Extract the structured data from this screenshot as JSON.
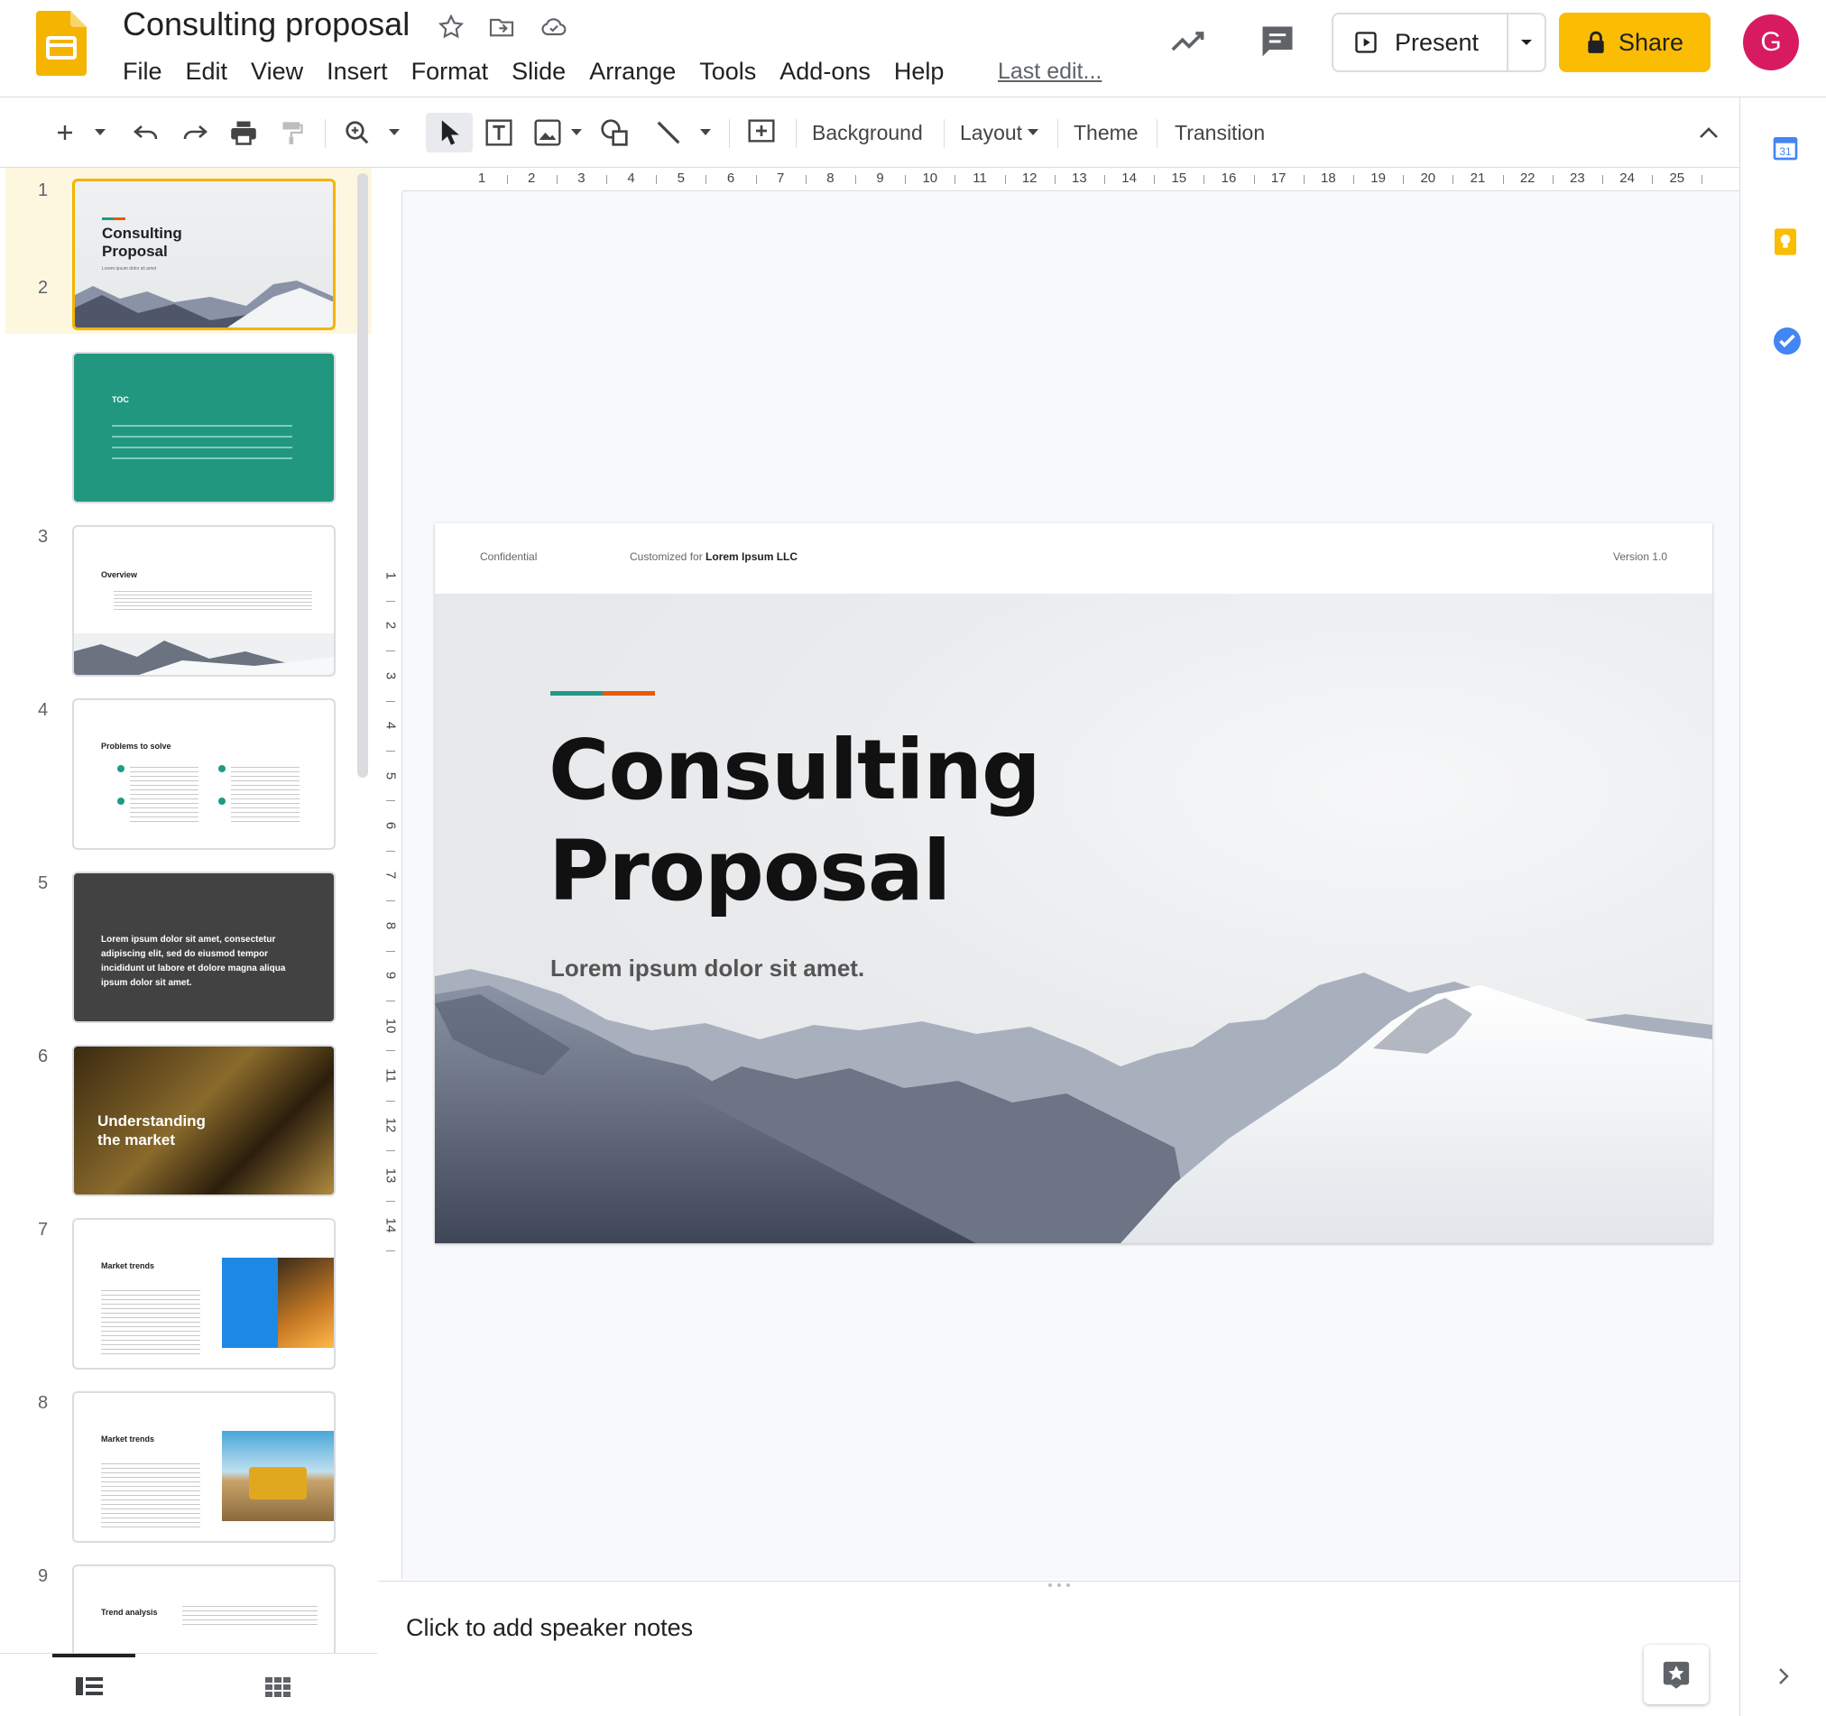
{
  "app": {
    "doc_title": "Consulting proposal",
    "menu": [
      "File",
      "Edit",
      "View",
      "Insert",
      "Format",
      "Slide",
      "Arrange",
      "Tools",
      "Add-ons",
      "Help"
    ],
    "last_edit": "Last edit...",
    "present_label": "Present",
    "share_label": "Share",
    "avatar_initial": "G"
  },
  "toolbar": {
    "background_label": "Background",
    "layout_label": "Layout",
    "theme_label": "Theme",
    "transition_label": "Transition"
  },
  "ruler": {
    "top": [
      "1",
      "2",
      "3",
      "4",
      "5",
      "6",
      "7",
      "8",
      "9",
      "10",
      "11",
      "12",
      "13",
      "14",
      "15",
      "16",
      "17",
      "18",
      "19",
      "20",
      "21",
      "22",
      "23",
      "24",
      "25"
    ],
    "left": [
      "1",
      "2",
      "3",
      "4",
      "5",
      "6",
      "7",
      "8",
      "9",
      "10",
      "11",
      "12",
      "13",
      "14"
    ]
  },
  "filmstrip": {
    "slides": [
      {
        "num": "1",
        "title": "Consulting Proposal",
        "subtitle": "Lorem ipsum dolor sit amet"
      },
      {
        "num": "2",
        "title": "TOC"
      },
      {
        "num": "3",
        "title": "Overview"
      },
      {
        "num": "4",
        "title": "Problems to solve"
      },
      {
        "num": "5",
        "title": "Lorem ipsum dolor sit amet, consectetur adipiscing elit, sed do eiusmod tempor incididunt ut labore et dolore magna aliqua ipsum dolor sit amet."
      },
      {
        "num": "6",
        "title": "Understanding the market"
      },
      {
        "num": "7",
        "title": "Market trends"
      },
      {
        "num": "8",
        "title": "Market trends"
      },
      {
        "num": "9",
        "title": "Trend analysis"
      }
    ]
  },
  "slide": {
    "confidential": "Confidential",
    "customized_prefix": "Customized for",
    "customized_client": "Lorem Ipsum LLC",
    "version": "Version 1.0",
    "title_line1": "Consulting",
    "title_line2": "Proposal",
    "subtitle": "Lorem ipsum dolor sit amet."
  },
  "notes": {
    "placeholder": "Click to add speaker notes"
  },
  "colors": {
    "share_yellow": "#fbbc04",
    "avatar_pink": "#d81b60",
    "accent_teal": "#1e9b87",
    "accent_orange": "#e8590c",
    "selected_thumb_bg": "#fef7e0",
    "toc_green": "#21977f",
    "dark_slide": "#424242"
  }
}
